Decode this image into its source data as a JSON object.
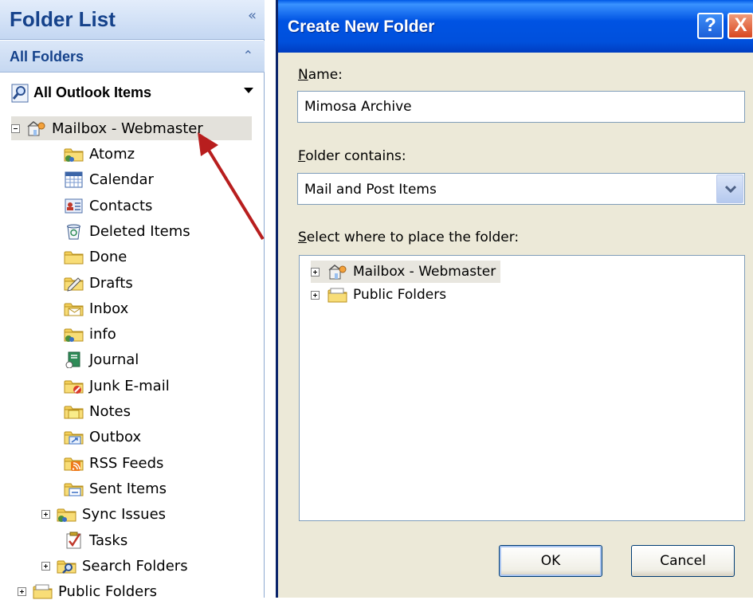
{
  "left_pane": {
    "title": "Folder List",
    "collapse_glyph": "«",
    "all_folders": "All Folders",
    "all_folders_glyph": "⌃",
    "all_items": "All Outlook Items",
    "mailbox": {
      "label": "Mailbox - Webmaster",
      "icon": "mailbox-icon"
    },
    "folders": [
      {
        "label": "Atomz",
        "icon": "shared-folder-icon"
      },
      {
        "label": "Calendar",
        "icon": "calendar-icon"
      },
      {
        "label": "Contacts",
        "icon": "contacts-icon"
      },
      {
        "label": "Deleted Items",
        "icon": "trash-icon"
      },
      {
        "label": "Done",
        "icon": "folder-icon"
      },
      {
        "label": "Drafts",
        "icon": "drafts-icon"
      },
      {
        "label": "Inbox",
        "icon": "inbox-icon"
      },
      {
        "label": "info",
        "icon": "shared-folder-icon"
      },
      {
        "label": "Journal",
        "icon": "journal-icon"
      },
      {
        "label": "Junk E-mail",
        "icon": "junk-icon"
      },
      {
        "label": "Notes",
        "icon": "notes-icon"
      },
      {
        "label": "Outbox",
        "icon": "outbox-icon"
      },
      {
        "label": "RSS Feeds",
        "icon": "rss-icon"
      },
      {
        "label": "Sent Items",
        "icon": "sent-icon"
      },
      {
        "label": "Sync Issues",
        "icon": "shared-folder-icon",
        "expandable": true
      },
      {
        "label": "Tasks",
        "icon": "tasks-icon"
      },
      {
        "label": "Search Folders",
        "icon": "search-folder-icon",
        "expandable": true
      }
    ],
    "public_folders": {
      "label": "Public Folders",
      "icon": "public-folders-icon"
    }
  },
  "dialog": {
    "title": "Create New Folder",
    "help_glyph": "?",
    "close_glyph": "X",
    "name_label_key": "N",
    "name_label_rest": "ame:",
    "name_value": "Mimosa Archive",
    "contains_label_key": "F",
    "contains_label_rest": "older contains:",
    "contains_value": "Mail and Post Items",
    "location_label_key": "S",
    "location_label_rest": "elect where to place the folder:",
    "location_tree": [
      {
        "label": "Mailbox - Webmaster",
        "icon": "mailbox-icon"
      },
      {
        "label": "Public Folders",
        "icon": "public-folders-icon"
      }
    ],
    "ok_label": "OK",
    "cancel_label": "Cancel"
  },
  "colors": {
    "header_blue": "#15428b",
    "titlebar": "#0053e3",
    "dialog_bg": "#ece9d8",
    "arrow": "#b81e1e"
  }
}
